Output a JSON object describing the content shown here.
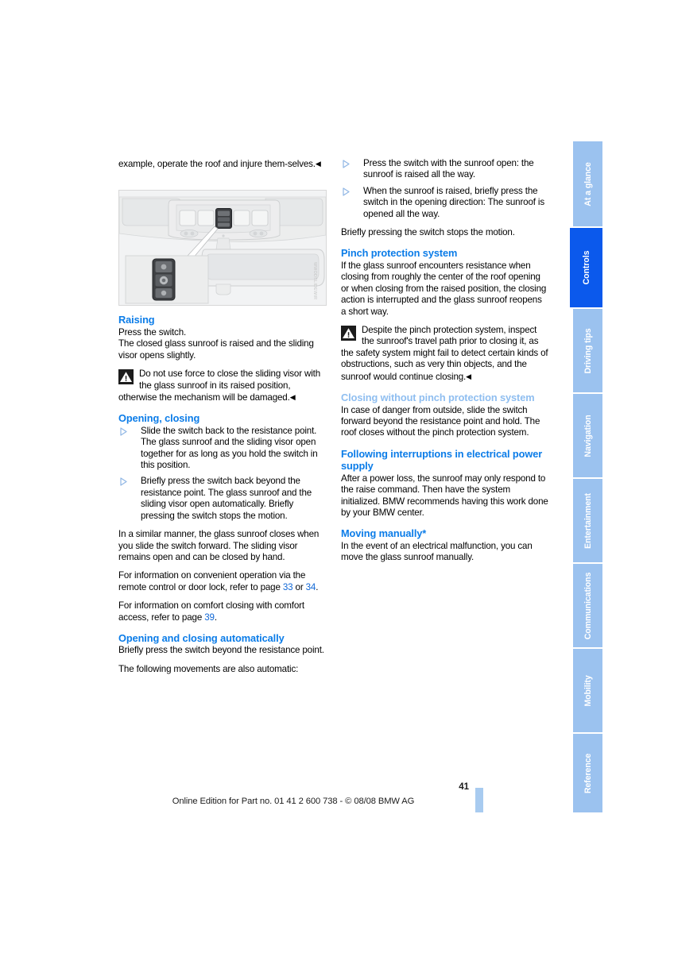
{
  "page": {
    "number": "41",
    "footer": "Online Edition for Part no. 01 41 2 600 738 - © 08/08 BMW AG",
    "figure_code": "WWODSLIDEWIR"
  },
  "left_column": {
    "continuation": "example, operate the roof and injure them-selves.",
    "continuation_endmark": "◀",
    "sections": [
      {
        "heading": "Raising",
        "paragraphs": [
          "Press the switch.",
          "The closed glass sunroof is raised and the sliding visor opens slightly."
        ],
        "warning": "Do not use force to close the sliding visor with the glass sunroof in its raised position, otherwise the mechanism will be damaged.",
        "warning_endmark": "◀"
      },
      {
        "heading": "Opening, closing",
        "bullets": [
          "Slide the switch back to the resistance point.\nThe glass sunroof and the sliding visor open together for as long as you hold the switch in this position.",
          "Briefly press the switch back beyond the resistance point.\nThe glass sunroof and the sliding visor open automatically. Briefly pressing the switch stops the motion."
        ],
        "paragraphs": [
          "In a similar manner, the glass sunroof closes when you slide the switch forward. The sliding visor remains open and can be closed by hand."
        ],
        "refs": [
          {
            "pre": "For information on convenient operation via the remote control or door lock, refer to page ",
            "link1": "33",
            "mid": " or ",
            "link2": "34",
            "post": "."
          },
          {
            "pre": "For information on comfort closing with comfort access, refer to page ",
            "link1": "39",
            "mid": "",
            "link2": "",
            "post": "."
          }
        ]
      },
      {
        "heading": "Opening and closing automatically",
        "paragraphs": [
          "Briefly press the switch beyond the resistance point.",
          "The following movements are also automatic:"
        ]
      }
    ]
  },
  "right_column": {
    "top_bullets": [
      "Press the switch with the sunroof open: the sunroof is raised all the way.",
      "When the sunroof is raised, briefly press the switch in the opening direction: The sunroof is opened all the way."
    ],
    "top_paragraph": "Briefly pressing the switch stops the motion.",
    "sections": [
      {
        "heading": "Pinch protection system",
        "dim": false,
        "paragraphs": [
          "If the glass sunroof encounters resistance when closing from roughly the center of the roof opening or when closing from the raised position, the closing action is interrupted and the glass sunroof reopens a short way."
        ],
        "warning": "Despite the pinch protection system, inspect the sunroof's travel path prior to closing it, as the safety system might fail to detect certain kinds of obstructions, such as very thin objects, and the sunroof would continue closing.",
        "warning_endmark": "◀"
      },
      {
        "heading": "Closing without pinch protection system",
        "dim": true,
        "paragraphs": [
          "In case of danger from outside, slide the switch forward beyond the resistance point and hold. The roof closes without the pinch protection system."
        ]
      },
      {
        "heading": "Following interruptions in electrical power supply",
        "dim": false,
        "paragraphs": [
          "After a power loss, the sunroof may only respond to the raise command. Then have the system initialized. BMW recommends having this work done by your BMW center."
        ]
      },
      {
        "heading": "Moving manually*",
        "dim": false,
        "paragraphs": [
          "In the event of an electrical malfunction, you can move the glass sunroof manually."
        ]
      }
    ]
  },
  "rail": {
    "tabs": [
      {
        "label": "At a glance",
        "active": false
      },
      {
        "label": "Controls",
        "active": true
      },
      {
        "label": "Driving tips",
        "active": false
      },
      {
        "label": "Navigation",
        "active": false
      },
      {
        "label": "Entertainment",
        "active": false
      },
      {
        "label": "Communications",
        "active": false
      },
      {
        "label": "Mobility",
        "active": false
      },
      {
        "label": "Reference",
        "active": false
      }
    ]
  },
  "colors": {
    "heading_blue": "#0b7ce8",
    "heading_blue_dim": "#8fbef0",
    "link_blue": "#1168d6",
    "tab_blue": "#9bc2ef",
    "tab_active_blue": "#0b59ec"
  }
}
